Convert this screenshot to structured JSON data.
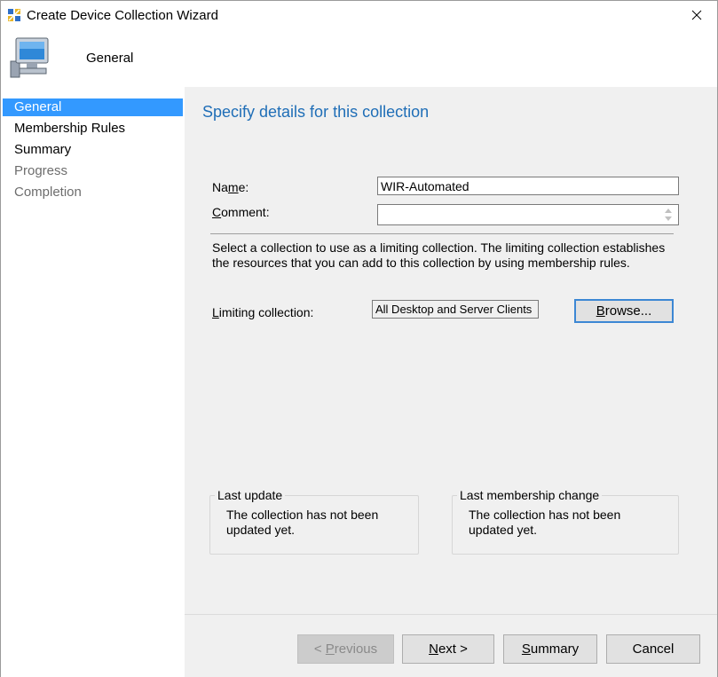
{
  "window": {
    "title": "Create Device Collection Wizard"
  },
  "header": {
    "title": "General"
  },
  "sidebar": {
    "items": [
      {
        "label": "General",
        "state": "active"
      },
      {
        "label": "Membership Rules",
        "state": "normal"
      },
      {
        "label": "Summary",
        "state": "normal"
      },
      {
        "label": "Progress",
        "state": "disabled"
      },
      {
        "label": "Completion",
        "state": "disabled"
      }
    ]
  },
  "main": {
    "section_title": "Specify details for this collection",
    "name_label_pre": "Na",
    "name_label_accel": "m",
    "name_label_post": "e:",
    "name_value": "WIR-Automated",
    "comment_label_accel": "C",
    "comment_label_post": "omment:",
    "comment_value": "",
    "description": "Select a collection to use as a limiting collection. The limiting collection establishes the resources that you can add to this collection by using membership rules.",
    "limiting_label_accel": "L",
    "limiting_label_post": "imiting collection:",
    "limiting_value": "All Desktop and Server Clients",
    "browse_accel": "B",
    "browse_post": "rowse...",
    "last_update": {
      "legend": "Last update",
      "text": "The collection has not been updated yet."
    },
    "last_membership_change": {
      "legend": "Last membership change",
      "text": "The collection has not been updated yet."
    }
  },
  "footer": {
    "previous_pre": "< ",
    "previous_accel": "P",
    "previous_post": "revious",
    "next_accel": "N",
    "next_post": "ext >",
    "summary_accel": "S",
    "summary_post": "ummary",
    "cancel_label": "Cancel"
  },
  "colors": {
    "accent": "#3399ff",
    "section_title": "#1f6eb7",
    "focus_border": "#3c87d4"
  },
  "icons": {
    "title": "wizard-app-icon",
    "header": "computer-monitor-icon",
    "close": "close-icon"
  }
}
